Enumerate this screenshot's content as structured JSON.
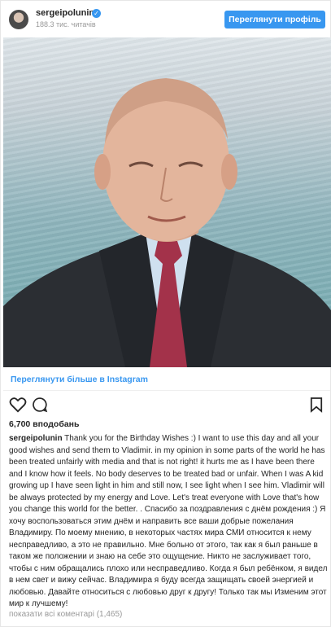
{
  "header": {
    "username": "sergeipolunin",
    "verified_badge": "✓",
    "followers": "188.3 тис. читачів",
    "view_profile_label": "Переглянути профіль"
  },
  "post": {
    "image_alt": "portrait photo",
    "more_on_instagram": "Переглянути більше в Instagram",
    "likes": "6,700 вподобань",
    "caption_user": "sergeipolunin",
    "caption_text": "Thank you for the Birthday Wishes :) I want to use this day and all your good wishes and send them to Vladimir. in my opinion in some parts of the world he has been treated unfairly with media and that is not right! it hurts me as I have been there and I know how it feels. No body deserves to be treated bad or unfair. When I was A kid growing up I have seen light in him and still now, I see light when I see him. Vladimir will be always protected by my energy and Love. Let's treat everyone with Love that's how you change this world for the better. . Спасибо за поздравления с днём рождения :) Я хочу воспользоваться этим днём и направить все ваши добрые пожелания Владимиру. По моему мнению, в некоторых частях мира СМИ относится к нему несправедливо, а это не правильно. Мне больно от этого, так как я был раньше в таком же положении и знаю на себе это ощущение. Никто не заслуживает того, чтобы с ним обращались плохо или несправедливо. Когда я был ребёнком, я видел в нем свет и вижу сейчас. Владимира я буду всегда защищать своей энергией и любовью. Давайте относиться с любовью друг к другу! Только так мы Изменим этот мир к лучшему!",
    "comments_link": "показати всі коментарі (1,465)"
  },
  "icons": {
    "like": "heart-icon",
    "comment": "comment-icon",
    "save": "bookmark-icon"
  },
  "colors": {
    "accent": "#3897f0",
    "text": "#262626",
    "muted": "#999999"
  }
}
